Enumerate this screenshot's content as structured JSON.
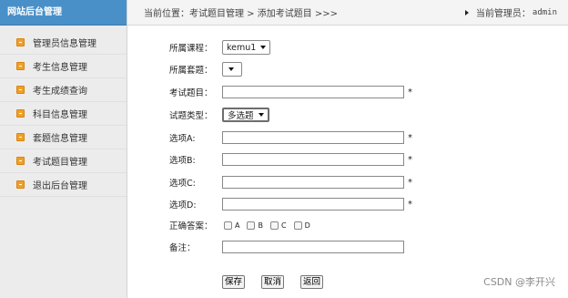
{
  "sidebar": {
    "title": "网站后台管理",
    "items": [
      {
        "label": "管理员信息管理"
      },
      {
        "label": "考生信息管理"
      },
      {
        "label": "考生成绩查询"
      },
      {
        "label": "科目信息管理"
      },
      {
        "label": "套题信息管理"
      },
      {
        "label": "考试题目管理"
      },
      {
        "label": "退出后台管理"
      }
    ]
  },
  "header": {
    "breadcrumb": "当前位置：考试题目管理 > 添加考试题目 >>>",
    "admin_label": "当前管理员：",
    "admin_name": "admin"
  },
  "form": {
    "course_label": "所属课程：",
    "course_value": "kemu1",
    "set_label": "所属套题：",
    "set_value": "",
    "question_label": "考试题目：",
    "type_label": "试题类型：",
    "type_value": "多选题",
    "optionA_label": "选项A:",
    "optionB_label": "选项B:",
    "optionC_label": "选项C:",
    "optionD_label": "选项D:",
    "answer_label": "正确答案：",
    "answers": [
      "A",
      "B",
      "C",
      "D"
    ],
    "note_label": "备注：",
    "required_mark": "*",
    "save_label": "保存",
    "cancel_label": "取消",
    "back_label": "返回"
  },
  "watermark": "CSDN @李开兴"
}
